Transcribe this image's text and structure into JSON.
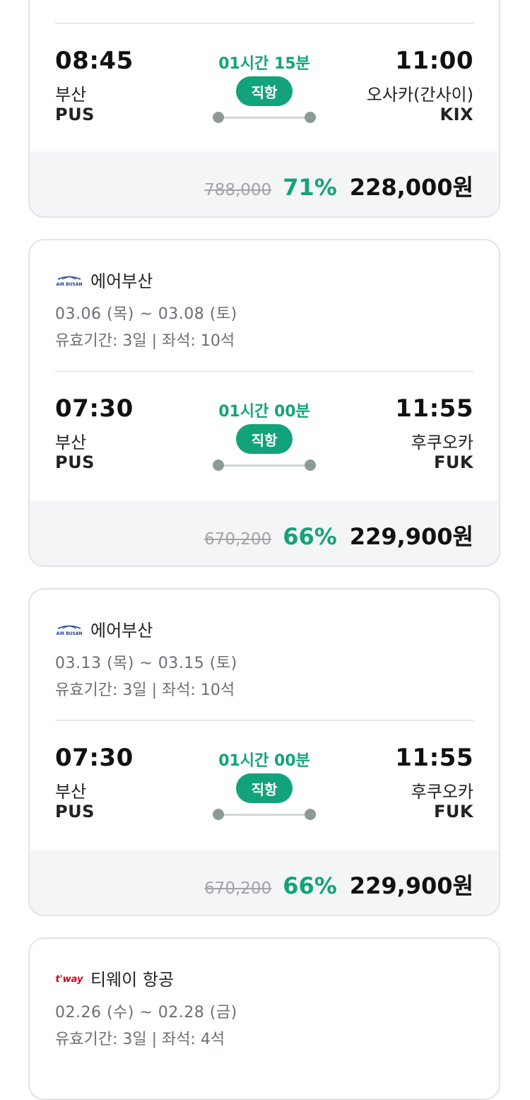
{
  "cards": [
    {
      "flight": {
        "dep_time": "08:45",
        "dep_city": "부산",
        "dep_code": "PUS",
        "arr_time": "11:00",
        "arr_city": "오사카(간사이)",
        "arr_code": "KIX",
        "duration": "01시간 15분",
        "type": "직항"
      },
      "price": {
        "original": "788,000",
        "discount": "71%",
        "final": "228,000원"
      }
    },
    {
      "airline": {
        "name": "에어부산",
        "logo_icon": "air-busan-logo",
        "logo_text": "AIR BUSAN"
      },
      "dates": "03.06 (목) ~ 03.08 (토)",
      "info": "유효기간: 3일 | 좌석: 10석",
      "flight": {
        "dep_time": "07:30",
        "dep_city": "부산",
        "dep_code": "PUS",
        "arr_time": "11:55",
        "arr_city": "후쿠오카",
        "arr_code": "FUK",
        "duration": "01시간 00분",
        "type": "직항"
      },
      "price": {
        "original": "670,200",
        "discount": "66%",
        "final": "229,900원"
      }
    },
    {
      "airline": {
        "name": "에어부산",
        "logo_icon": "air-busan-logo",
        "logo_text": "AIR BUSAN"
      },
      "dates": "03.13 (목) ~ 03.15 (토)",
      "info": "유효기간: 3일 | 좌석: 10석",
      "flight": {
        "dep_time": "07:30",
        "dep_city": "부산",
        "dep_code": "PUS",
        "arr_time": "11:55",
        "arr_city": "후쿠오카",
        "arr_code": "FUK",
        "duration": "01시간 00분",
        "type": "직항"
      },
      "price": {
        "original": "670,200",
        "discount": "66%",
        "final": "229,900원"
      }
    },
    {
      "airline": {
        "name": "티웨이 항공",
        "logo_icon": "tway-logo",
        "logo_text": "t'way"
      },
      "dates": "02.26 (수) ~ 02.28 (금)",
      "info": "유효기간: 3일 | 좌석: 4석"
    }
  ],
  "colors": {
    "accent_green": "#13a37a",
    "route_dot": "#8d9b96",
    "price_bar_bg": "#f4f5f6",
    "card_border": "#e1e3e6",
    "air_busan_blue": "#1c3f94",
    "tway_red": "#d6001c"
  }
}
